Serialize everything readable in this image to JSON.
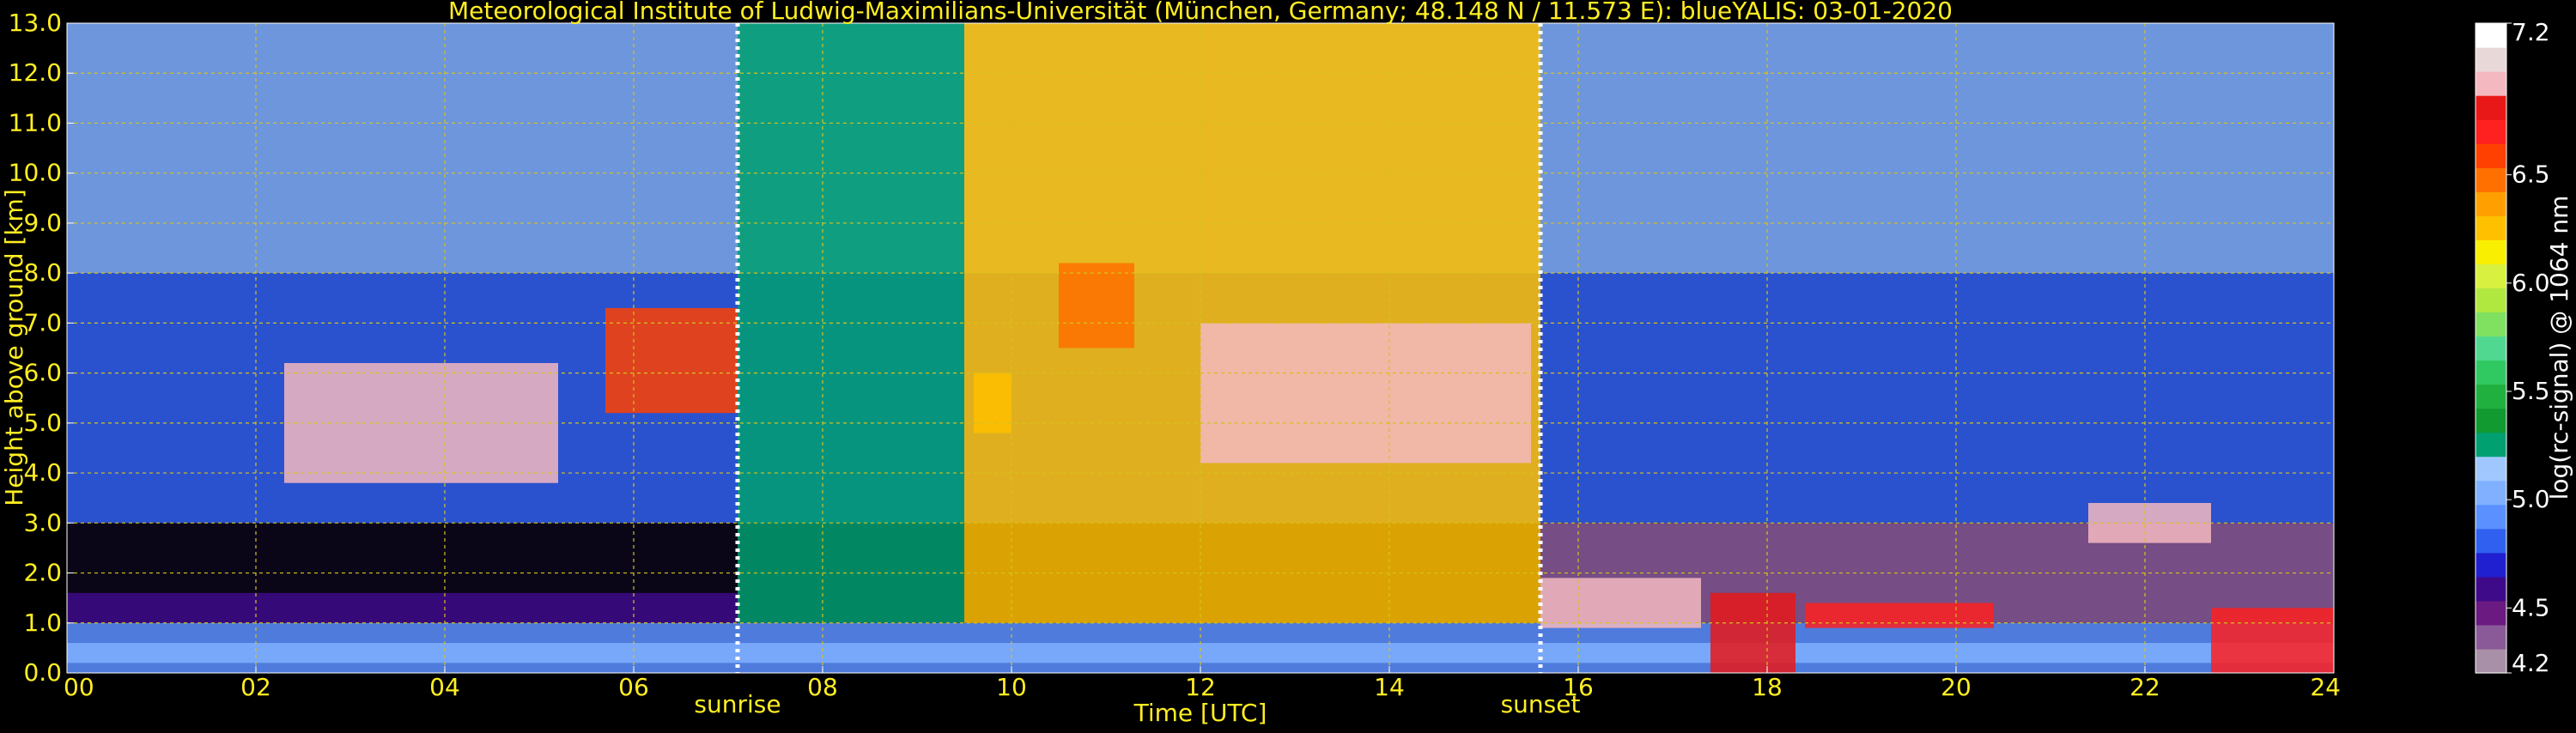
{
  "colors": {
    "background": "#000000",
    "text_primary": "#ffee22",
    "text_colorbar": "#ffffff",
    "grid": "#d6c21a",
    "marker": "#ffffff"
  },
  "chart_data": {
    "type": "heatmap",
    "title": "Meteorological Institute of Ludwig-Maximilians-Universität (München, Germany; 48.148 N / 11.573 E):    blueYALIS: 03-01-2020",
    "xlabel": "Time [UTC]",
    "ylabel": "Height above ground [km]",
    "xlim": [
      0,
      24
    ],
    "ylim": [
      0,
      13
    ],
    "x_ticks": [
      0,
      2,
      4,
      6,
      8,
      10,
      12,
      14,
      16,
      18,
      20,
      22,
      24
    ],
    "x_tick_labels": [
      "00",
      "02",
      "04",
      "06",
      "08",
      "10",
      "12",
      "14",
      "16",
      "18",
      "20",
      "22",
      "24"
    ],
    "y_ticks": [
      0,
      1,
      2,
      3,
      4,
      5,
      6,
      7,
      8,
      9,
      10,
      11,
      12,
      13
    ],
    "y_tick_labels": [
      "0.0",
      "1.0",
      "2.0",
      "3.0",
      "4.0",
      "5.0",
      "6.0",
      "7.0",
      "8.0",
      "9.0",
      "10.0",
      "11.0",
      "12.0",
      "13.0"
    ],
    "grid": true,
    "colorbar": {
      "label": "log(rc-signal) @ 1064 nm",
      "range": [
        4.2,
        7.2
      ],
      "ticks": [
        4.2,
        4.5,
        5.0,
        5.5,
        6.0,
        6.5,
        7.2
      ],
      "tick_labels": [
        "4.2",
        "4.5",
        "5.0",
        "5.5",
        "6.0",
        "6.5",
        "7.2"
      ],
      "colors": [
        "#a890a8",
        "#8a5a98",
        "#6a1a80",
        "#3e0a8a",
        "#2020d0",
        "#3060f0",
        "#5a90ff",
        "#80b0ff",
        "#a0c8ff",
        "#00a070",
        "#109a30",
        "#20b040",
        "#30c860",
        "#50d890",
        "#80e060",
        "#b0e840",
        "#d8f040",
        "#f8f000",
        "#ffc000",
        "#ffa000",
        "#ff7000",
        "#ff4000",
        "#ff2020",
        "#e81818",
        "#f4b8c0",
        "#e8d8d8",
        "#ffffff"
      ]
    },
    "markers": [
      {
        "label": "sunrise",
        "x": 7.1
      },
      {
        "label": "sunset",
        "x": 15.6
      }
    ],
    "regions": [
      {
        "x0": 0.0,
        "x1": 24.0,
        "y0": 0.0,
        "y1": 1.0,
        "level": 4.9
      },
      {
        "x0": 0.0,
        "x1": 7.1,
        "y0": 1.0,
        "y1": 1.6,
        "level": 4.55
      },
      {
        "x0": 15.6,
        "x1": 24.0,
        "y0": 1.0,
        "y1": 3.0,
        "level": 4.4
      },
      {
        "x0": 0.0,
        "x1": 24.0,
        "y0": 3.0,
        "y1": 8.0,
        "level": 4.8
      },
      {
        "x0": 0.0,
        "x1": 24.0,
        "y0": 8.0,
        "y1": 13.0,
        "level": 5.05
      },
      {
        "x0": 7.1,
        "x1": 9.5,
        "y0": 1.0,
        "y1": 13.0,
        "level": 5.3
      },
      {
        "x0": 9.5,
        "x1": 15.6,
        "y0": 1.0,
        "y1": 13.0,
        "level": 6.2
      },
      {
        "x0": 0.0,
        "x1": 24.0,
        "y0": 0.2,
        "y1": 0.6,
        "level": 5.0
      },
      {
        "x0": 2.3,
        "x1": 5.2,
        "y0": 3.8,
        "y1": 6.2,
        "level": 6.9
      },
      {
        "x0": 5.7,
        "x1": 7.1,
        "y0": 5.2,
        "y1": 7.3,
        "level": 6.6
      },
      {
        "x0": 9.6,
        "x1": 10.0,
        "y0": 4.8,
        "y1": 6.0,
        "level": 6.2
      },
      {
        "x0": 10.5,
        "x1": 11.3,
        "y0": 6.5,
        "y1": 8.2,
        "level": 6.5
      },
      {
        "x0": 12.0,
        "x1": 15.5,
        "y0": 4.2,
        "y1": 7.0,
        "level": 6.9
      },
      {
        "x0": 15.6,
        "x1": 17.3,
        "y0": 0.9,
        "y1": 1.9,
        "level": 6.9
      },
      {
        "x0": 17.4,
        "x1": 18.3,
        "y0": 0.0,
        "y1": 1.6,
        "level": 6.8
      },
      {
        "x0": 18.4,
        "x1": 20.4,
        "y0": 0.9,
        "y1": 1.4,
        "level": 6.7
      },
      {
        "x0": 21.4,
        "x1": 22.7,
        "y0": 2.6,
        "y1": 3.4,
        "level": 6.9
      },
      {
        "x0": 22.7,
        "x1": 24.0,
        "y0": 0.0,
        "y1": 1.3,
        "level": 6.7
      }
    ]
  }
}
